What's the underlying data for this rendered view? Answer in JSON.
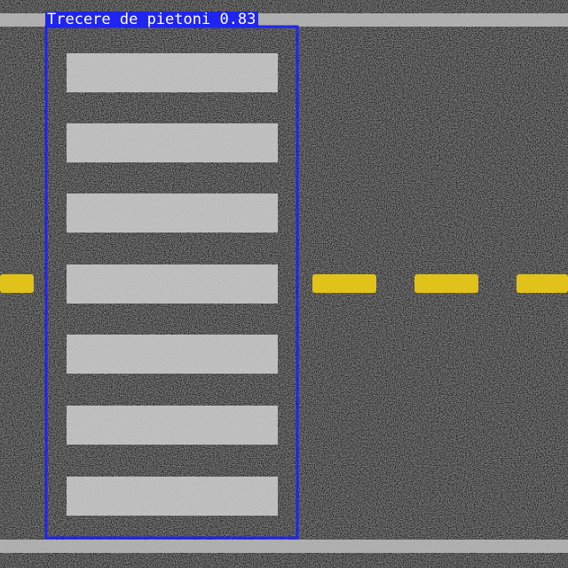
{
  "detection": {
    "label": "Trecere de pietoni 0.83",
    "box_color": "#1f24f0",
    "label_text_color": "#ffffff"
  },
  "colors": {
    "asphalt": "#1c1c1c",
    "lane_line_white": "#bdbdbd",
    "crosswalk_stripe": "#c8c8c8",
    "center_line_yellow": "#e0c21a"
  }
}
